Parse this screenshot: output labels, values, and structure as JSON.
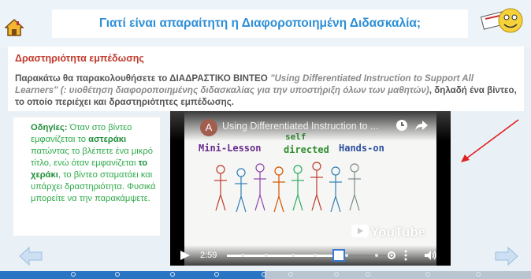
{
  "header": {
    "title": "Γιατί είναι απαραίτητη η Διαφοροποιημένη Διδασκαλία;",
    "home_icon": "home-icon",
    "mascot_icon": "smiley-mascot-icon"
  },
  "activity": {
    "title": "Δραστηριότητα εμπέδωσης",
    "intro": "Παρακάτω θα παρακολουθήσετε το ΔΙΑΔΡΑΣΤΙΚΟ ΒΙΝΤΕΟ",
    "quote": "\"Using Differentiated Instruction to Support All Learners\" (: υιοθέτηση διαφοροποιημένης διδασκαλίας για την υποστήριξη όλων των μαθητών)",
    "outro": ", δηλαδή ένα βίντεο, το οποίο περιέχει και δραστηριότητες εμπέδωσης."
  },
  "instructions": {
    "label": "Οδηγίες:",
    "t1": " Όταν στο βίντεο εμφανίζεται το ",
    "b1": "αστεράκι",
    "t2": " πατώντας το βλέπετε ένα μικρό τίτλο, ενώ όταν εμφανίζεται ",
    "b2": "το χεράκι",
    "t3": ", το βίντεο σταματάει και υπάρχει δραστηριότητα. Φυσικά μπορείτε να την παρακάμψετε."
  },
  "video": {
    "channel_initial": "A",
    "title": "Using Differentiated Instruction to ...",
    "label_mini": "Mini-Lesson",
    "label_self": "self",
    "label_directed": "directed",
    "label_hands": "Hands-on",
    "logo": "YouTube",
    "time": "2:59",
    "progress": 0.69,
    "icons": [
      "clock-icon",
      "share-icon",
      "play-icon",
      "settings-icon",
      "more-icon",
      "volume-icon"
    ]
  },
  "colors": {
    "title": "#2d8fd6",
    "activity_title": "#c0392b",
    "instructions": "#2eaa4a",
    "bottom_bar": "#2a74c4",
    "arrow": "#e02020"
  },
  "navigation": {
    "prev_icon": "arrow-left-icon",
    "next_icon": "arrow-right-icon"
  }
}
